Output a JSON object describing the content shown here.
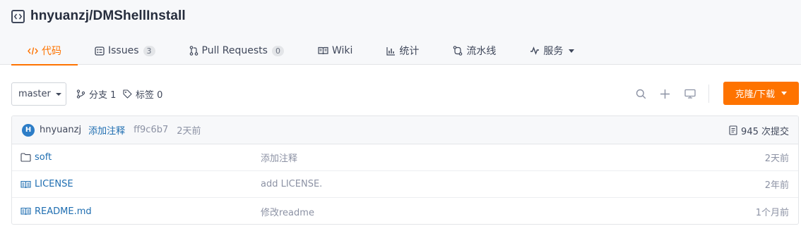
{
  "repo": {
    "owner_name": "hnyuanzj/DMShellInstall",
    "icon": "code-box-icon"
  },
  "tabs": [
    {
      "label": "代码",
      "icon": "code-icon",
      "active": true
    },
    {
      "label": "Issues",
      "icon": "issues-icon",
      "count": "3"
    },
    {
      "label": "Pull Requests",
      "icon": "pull-request-icon",
      "count": "0"
    },
    {
      "label": "Wiki",
      "icon": "book-icon"
    },
    {
      "label": "统计",
      "icon": "bar-chart-icon"
    },
    {
      "label": "流水线",
      "icon": "pipeline-icon"
    },
    {
      "label": "服务",
      "icon": "pulse-icon",
      "dropdown": true
    }
  ],
  "toolbar": {
    "branch": "master",
    "branches_label": "分支 1",
    "tags_label": "标签 0",
    "clone_label": "克隆/下载",
    "icons": [
      "search-icon",
      "plus-icon",
      "monitor-icon"
    ]
  },
  "commit": {
    "avatar_letter": "H",
    "author": "hnyuanzj",
    "message": "添加注释",
    "sha": "ff9c6b7",
    "time": "2天前",
    "count_label": "945 次提交"
  },
  "files": [
    {
      "name": "soft",
      "type": "folder",
      "icon": "folder-icon",
      "message": "添加注释",
      "time": "2天前"
    },
    {
      "name": "LICENSE",
      "type": "file",
      "icon": "book-icon",
      "message": "add LICENSE.",
      "time": "2年前"
    },
    {
      "name": "README.md",
      "type": "file",
      "icon": "book-icon",
      "message": "修改readme",
      "time": "1个月前"
    }
  ],
  "colors": {
    "accent": "#fe7300",
    "link": "#1f6eb1",
    "muted": "#8c92a4",
    "text": "#40485b"
  }
}
